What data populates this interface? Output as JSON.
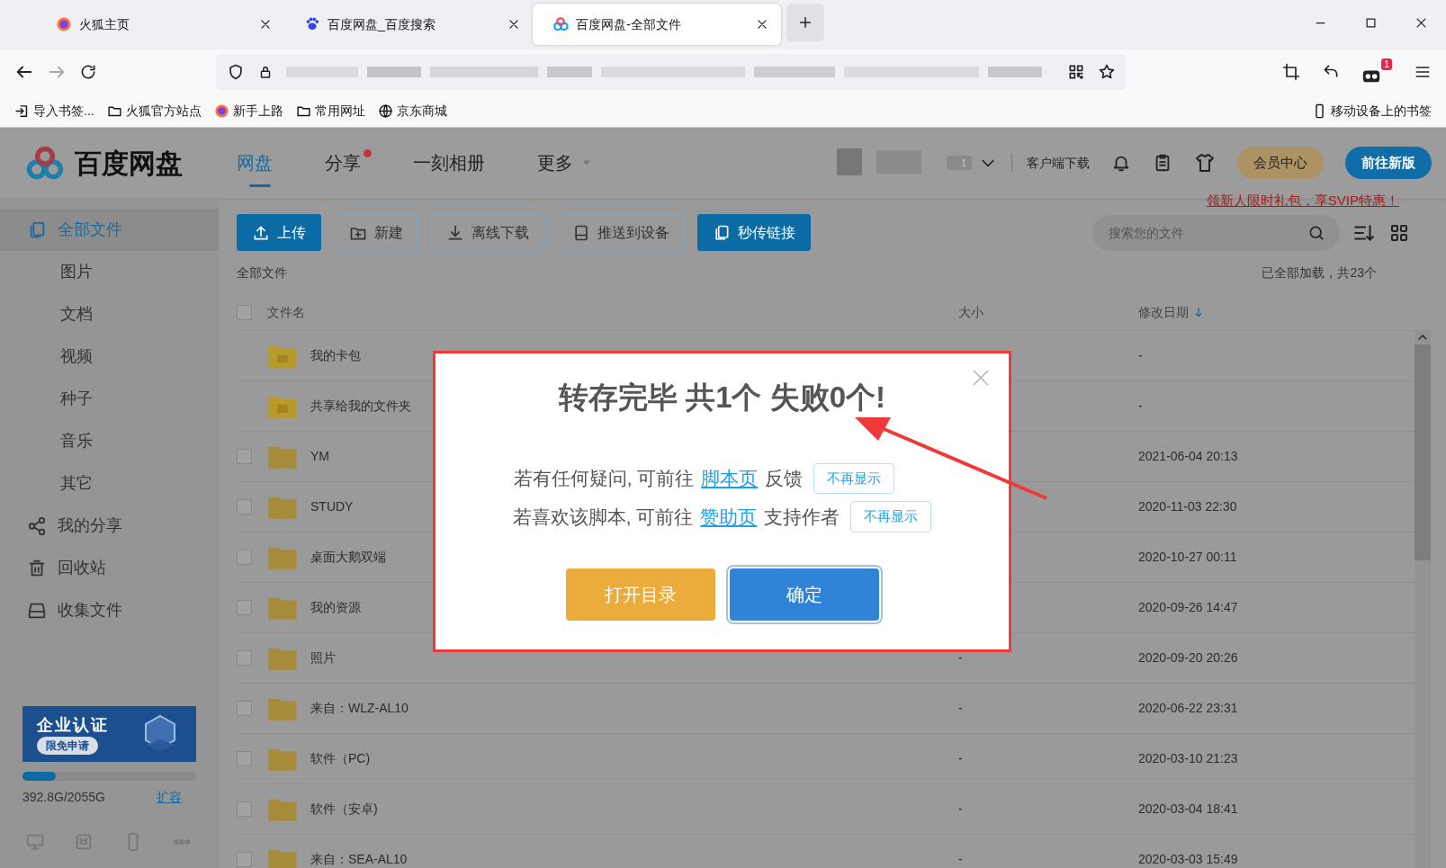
{
  "browser": {
    "tabs": [
      {
        "title": "火狐主页",
        "selected": false
      },
      {
        "title": "百度网盘_百度搜索",
        "selected": false
      },
      {
        "title": "百度网盘-全部文件",
        "selected": true
      }
    ],
    "extension_badge": "1",
    "bookmarks": [
      {
        "label": "导入书签..."
      },
      {
        "label": "火狐官方站点"
      },
      {
        "label": "新手上路"
      },
      {
        "label": "常用网址"
      },
      {
        "label": "京东商城"
      }
    ],
    "mobile_bookmarks": "移动设备上的书签"
  },
  "app": {
    "logo": "百度网盘",
    "nav": [
      {
        "label": "网盘",
        "selected": true,
        "dot": false,
        "caret": false
      },
      {
        "label": "分享",
        "selected": false,
        "dot": true,
        "caret": false
      },
      {
        "label": "一刻相册",
        "selected": false,
        "dot": false,
        "caret": false
      },
      {
        "label": "更多",
        "selected": false,
        "dot": false,
        "caret": true
      }
    ],
    "vip_badge": "1",
    "client_download": "客户端下载",
    "member_button": "会员中心",
    "new_version_button": "前往新版",
    "promo_link": "领新人限时礼包，享SVIP特惠！"
  },
  "sidebar": {
    "items": [
      {
        "label": "全部文件",
        "selected": true,
        "children": [
          {
            "label": "图片",
            "selected": false
          },
          {
            "label": "文档",
            "selected": false
          },
          {
            "label": "视频",
            "selected": false
          },
          {
            "label": "种子",
            "selected": false
          },
          {
            "label": "音乐",
            "selected": false
          },
          {
            "label": "其它",
            "selected": false
          }
        ]
      },
      {
        "label": "我的分享",
        "selected": false
      },
      {
        "label": "回收站",
        "selected": false
      },
      {
        "label": "收集文件",
        "selected": false
      }
    ],
    "banner": {
      "title": "企业认证",
      "button": "限免申请"
    },
    "storage": {
      "level": 0.19,
      "reading": "392.8G/2055G",
      "expand_link": "扩容"
    }
  },
  "toolbar": {
    "buttons": [
      {
        "label": "上传",
        "primary": true
      },
      {
        "label": "新建",
        "primary": false
      },
      {
        "label": "离线下载",
        "primary": false
      },
      {
        "label": "推送到设备",
        "primary": false
      },
      {
        "label": "秒传链接",
        "primary": true
      }
    ],
    "search": {
      "placeholder": "搜索您的文件"
    }
  },
  "breadcrumb": "全部文件",
  "load_status": "已全部加载，共23个",
  "table": {
    "select_all": {
      "checked": false
    },
    "columns": [
      {
        "label": "文件名",
        "sorted": false
      },
      {
        "label": "大小",
        "sorted": false
      },
      {
        "label": "修改日期",
        "sorted": true
      }
    ],
    "rows": [
      {
        "name": "我的卡包",
        "kind": "wallet",
        "date": "-"
      },
      {
        "name": "共享给我的文件夹",
        "kind": "shared",
        "date": "-"
      },
      {
        "name": "YM",
        "kind": "folder",
        "checked": false,
        "date": "2021-06-04 20:13"
      },
      {
        "name": "STUDY",
        "kind": "folder",
        "checked": false,
        "date": "2020-11-03 22:30"
      },
      {
        "name": "桌面大鹅双端",
        "kind": "folder",
        "checked": false,
        "date": "2020-10-27 00:11"
      },
      {
        "name": "我的资源",
        "kind": "folder",
        "checked": false,
        "date": "2020-09-26 14:47"
      },
      {
        "name": "照片",
        "kind": "folder",
        "checked": false,
        "size": "-",
        "date": "2020-09-20 20:26"
      },
      {
        "name": "来自：WLZ-AL10",
        "kind": "folder",
        "checked": false,
        "size": "-",
        "date": "2020-06-22 23:31"
      },
      {
        "name": "软件（PC)",
        "kind": "folder",
        "checked": false,
        "size": "-",
        "date": "2020-03-10 21:23"
      },
      {
        "name": "软件（安卓)",
        "kind": "folder",
        "checked": false,
        "size": "-",
        "date": "2020-03-04 18:41"
      },
      {
        "name": "来自：SEA-AL10",
        "kind": "folder",
        "checked": false,
        "size": "-",
        "date": "2020-03-03 15:49"
      }
    ]
  },
  "dialog": {
    "title": "转存完毕 共1个 失败0个!",
    "lines": [
      {
        "before": "若有任何疑问, 可前往",
        "link": "脚本页",
        "after": "反馈",
        "dismiss": "不再显示"
      },
      {
        "before": "若喜欢该脚本, 可前往",
        "link": "赞助页",
        "after": "支持作者",
        "dismiss": "不再显示"
      }
    ],
    "buttons": [
      {
        "label": "打开目录",
        "kind": "open"
      },
      {
        "label": "确定",
        "kind": "confirm"
      }
    ]
  }
}
